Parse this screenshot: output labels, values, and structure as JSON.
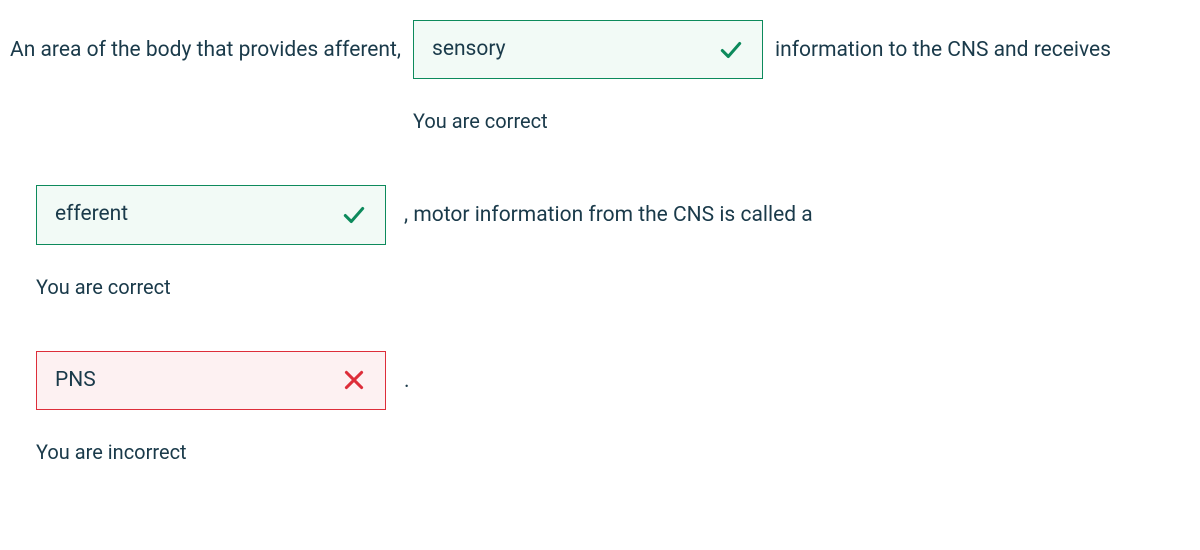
{
  "question": {
    "segments": {
      "s1": "An area of the body that provides afferent,",
      "s2": "information to the CNS and receives",
      "s3": ", motor information from the CNS is called a",
      "s4": "."
    }
  },
  "answers": {
    "a1": {
      "value": "sensory",
      "status": "correct",
      "feedback": "You are correct"
    },
    "a2": {
      "value": "efferent",
      "status": "correct",
      "feedback": "You are correct"
    },
    "a3": {
      "value": "PNS",
      "status": "incorrect",
      "feedback": "You are incorrect"
    }
  },
  "colors": {
    "correct_border": "#0d8a5c",
    "correct_bg": "#f2faf6",
    "incorrect_border": "#dd2e3a",
    "incorrect_bg": "#fdf1f2",
    "text": "#1a3a4a"
  }
}
